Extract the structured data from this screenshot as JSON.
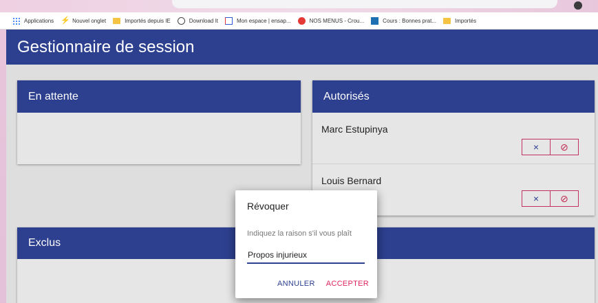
{
  "bookmarks": [
    {
      "label": "Applications",
      "icon": "apps-grid-icon"
    },
    {
      "label": "Nouvel onglet",
      "icon": "lightning-icon"
    },
    {
      "label": "Importés depuis IE",
      "icon": "folder-icon"
    },
    {
      "label": "Download It",
      "icon": "globe-icon"
    },
    {
      "label": "Mon espace | ensap...",
      "icon": "book-icon"
    },
    {
      "label": "NOS MENUS - Crou...",
      "icon": "red-circle-icon"
    },
    {
      "label": "Cours : Bonnes prat...",
      "icon": "document-icon"
    },
    {
      "label": "Importés",
      "icon": "folder-icon"
    }
  ],
  "app": {
    "title": "Gestionnaire de session",
    "colors": {
      "primary": "#2d3f8f",
      "accent": "#e0245e",
      "background": "#dedede"
    }
  },
  "cards": {
    "attente": {
      "title": "En attente"
    },
    "autorises": {
      "title": "Autorisés",
      "people": [
        {
          "name": "Marc Estupinya",
          "remove_symbol": "×",
          "ban_symbol": "⊘"
        },
        {
          "name": "Louis Bernard",
          "remove_symbol": "×",
          "ban_symbol": "⊘"
        }
      ]
    },
    "exclus": {
      "title": "Exclus"
    }
  },
  "dialog": {
    "title": "Révoquer",
    "message": "Indiquez la raison s'il vous plaît",
    "input_value": "Propos injurieux",
    "cancel_label": "ANNULER",
    "accept_label": "ACCEPTER"
  }
}
